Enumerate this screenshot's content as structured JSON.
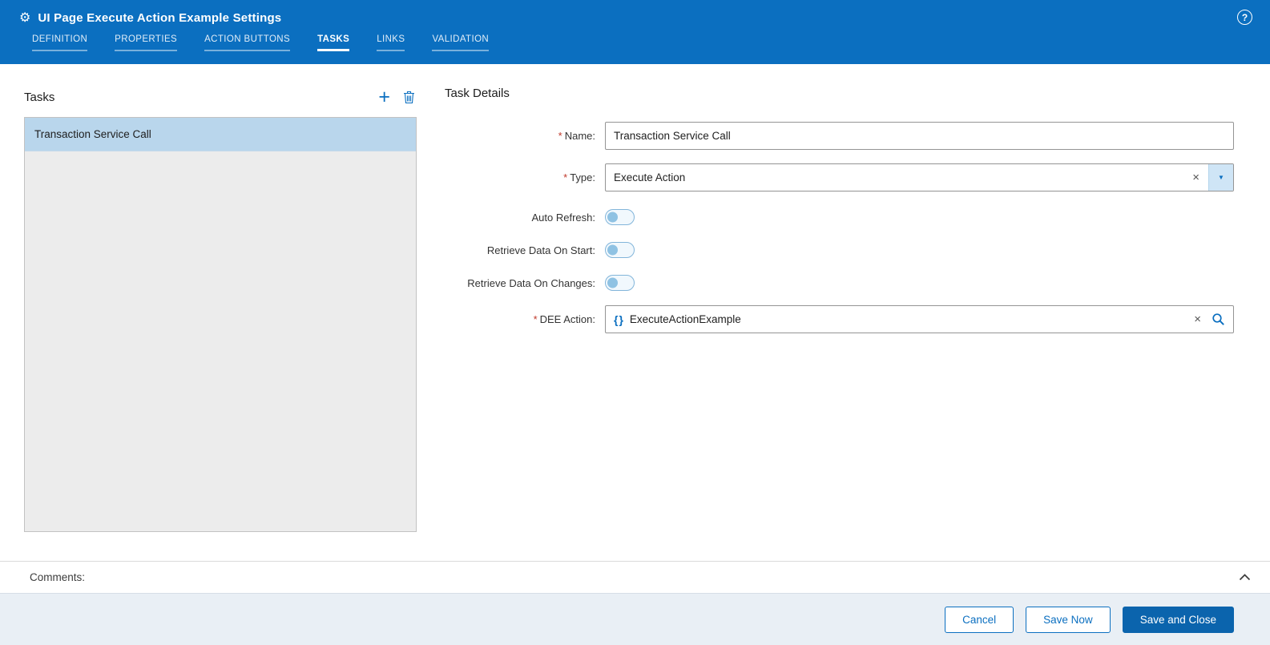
{
  "header": {
    "title": "UI Page Execute Action Example Settings",
    "tabs": [
      {
        "label": "DEFINITION"
      },
      {
        "label": "PROPERTIES"
      },
      {
        "label": "ACTION BUTTONS"
      },
      {
        "label": "TASKS"
      },
      {
        "label": "LINKS"
      },
      {
        "label": "VALIDATION"
      }
    ],
    "active_tab": "TASKS"
  },
  "icons": {
    "gear": "⚙",
    "help": "?",
    "add": "+",
    "clear": "×",
    "caret": "▼",
    "braces": "{}"
  },
  "tasks_panel": {
    "title": "Tasks",
    "items": [
      {
        "label": "Transaction Service Call",
        "selected": true
      }
    ]
  },
  "task_details": {
    "title": "Task Details",
    "required_marker": "*",
    "name": {
      "label": "Name:",
      "value": "Transaction Service Call",
      "required": true
    },
    "type": {
      "label": "Type:",
      "value": "Execute Action",
      "required": true
    },
    "auto_refresh": {
      "label": "Auto Refresh:",
      "on": false
    },
    "retrieve_data_on_start": {
      "label": "Retrieve Data On Start:",
      "on": false
    },
    "retrieve_data_on_changes": {
      "label": "Retrieve Data On Changes:",
      "on": false
    },
    "dee_action": {
      "label": "DEE Action:",
      "value": "ExecuteActionExample",
      "required": true
    }
  },
  "comments": {
    "label": "Comments:"
  },
  "footer": {
    "cancel_label": "Cancel",
    "save_now_label": "Save Now",
    "save_and_close_label": "Save and Close"
  },
  "colors": {
    "header_blue": "#0b6fc0",
    "accent_blue": "#0b6fc0",
    "primary_button_blue": "#0b64ad",
    "selected_item_bg": "#b9d6ec",
    "list_bg": "#ececec",
    "required_red": "#c0392b",
    "footer_bg": "#e9eff5"
  }
}
